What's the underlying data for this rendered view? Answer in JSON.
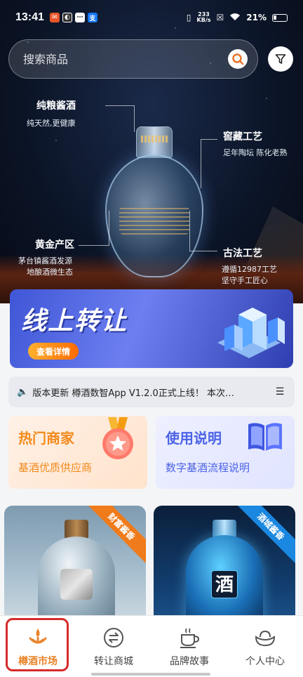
{
  "status_bar": {
    "time": "13:41",
    "network_speed_top": "233",
    "network_speed_unit": "KB/s",
    "battery": "21%"
  },
  "search": {
    "placeholder": "搜索商品"
  },
  "hero": {
    "callouts": [
      {
        "title": "纯粮酱酒",
        "subtitle": "纯天然,更健康"
      },
      {
        "title": "窖藏工艺",
        "subtitle": "足年陶坛 陈化老熟"
      },
      {
        "title": "黄金产区",
        "subtitle_line1": "茅台镇酱酒发源",
        "subtitle_line2": "地酿酒微生态"
      },
      {
        "title": "古法工艺",
        "subtitle_line1": "遵循12987工艺",
        "subtitle_line2": "坚守手工匠心"
      }
    ]
  },
  "promo": {
    "title": "线上转让",
    "cta": "查看详情"
  },
  "notice": {
    "text": "版本更新 樽酒数智App V1.2.0正式上线！ 本次…"
  },
  "cards": [
    {
      "title": "热门商家",
      "subtitle": "基酒优质供应商"
    },
    {
      "title": "使用说明",
      "subtitle": "数字基酒流程说明"
    }
  ],
  "products": [
    {
      "ribbon": "财富酱香",
      "ribbon_color": "#f07b1a"
    },
    {
      "ribbon": "酒城酱香",
      "ribbon_color": "#1a87e0",
      "jar_char": "酒"
    }
  ],
  "nav": {
    "items": [
      {
        "label": "樽酒市场",
        "icon": "signal-drop-icon",
        "active": true
      },
      {
        "label": "转让商城",
        "icon": "exchange-icon",
        "active": false
      },
      {
        "label": "品牌故事",
        "icon": "coffee-cup-icon",
        "active": false
      },
      {
        "label": "个人中心",
        "icon": "ingot-icon",
        "active": false
      }
    ],
    "active_color": "#e9842a",
    "highlight_color": "#d62b2b"
  }
}
